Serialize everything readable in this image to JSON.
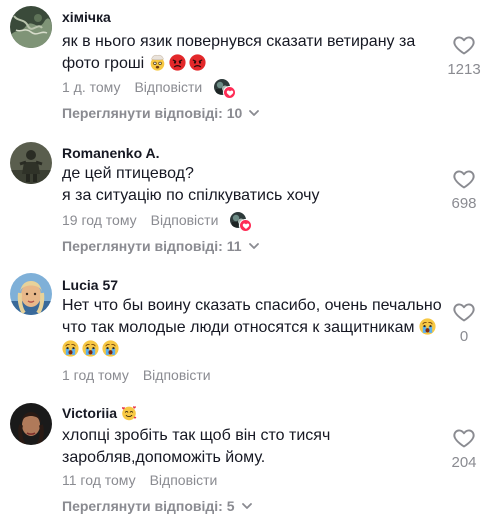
{
  "comments": [
    {
      "username": "хімічка",
      "text": "як в нього язик повернувся сказати ветирану за фото гроші",
      "emoji": [
        "exploding-head-emoji",
        "angry-face-emoji",
        "angry-face-emoji"
      ],
      "time": "1 д. тому",
      "reply_label": "Відповісти",
      "liked_by_creator": true,
      "view_replies": "Переглянути відповіді: 10",
      "likes": "1213"
    },
    {
      "username": "Romanenko A.",
      "text_lines": [
        "де цей птицевод?",
        "я за ситуацію по спілкуватись хочу"
      ],
      "time": "19 год тому",
      "reply_label": "Відповісти",
      "liked_by_creator": true,
      "view_replies": "Переглянути відповіді: 11",
      "likes": "698"
    },
    {
      "username": "Lucia 57",
      "text": "Нет что бы воину сказать спасибо, очень печально что так молодые люди относятся к защитникам",
      "emoji": [
        "crying-face-emoji",
        "crying-face-emoji",
        "crying-face-emoji",
        "crying-face-emoji"
      ],
      "time": "1 год тому",
      "reply_label": "Відповісти",
      "likes": "0"
    },
    {
      "username": "Victoriia",
      "username_emoji": "smiling-face-with-hearts-emoji",
      "text": "хлопці зробіть так щоб він сто тисяч заробляв,допоможіть йому.",
      "time": "11 год тому",
      "reply_label": "Відповісти",
      "view_replies": "Переглянути відповіді: 5",
      "likes": "204"
    }
  ],
  "colors": {
    "text": "#161823",
    "muted": "#8a8b91",
    "accent": "#fe2c55"
  },
  "icons": {
    "like": "heart-outline-icon",
    "expand": "chevron-down-icon"
  }
}
